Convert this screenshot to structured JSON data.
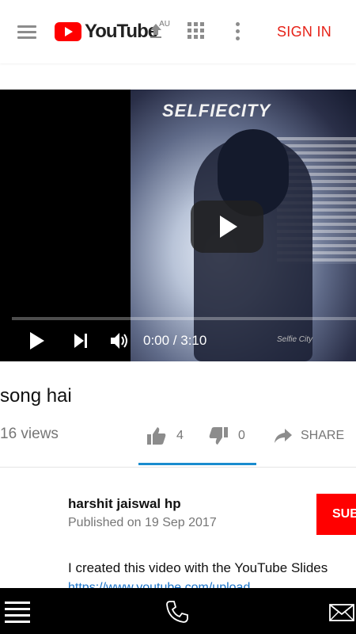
{
  "header": {
    "logo_text": "YouTube",
    "region_text": "AU",
    "signin_label": "SIGN IN",
    "icons": [
      "menu-icon",
      "upload-icon",
      "apps-icon",
      "more-vert-icon"
    ]
  },
  "player": {
    "thumbnail_title": "SELFIECITY",
    "thumbnail_signature": "Selfie City",
    "time": "0:00 / 3:10",
    "progress": 0,
    "icons": [
      "play-icon",
      "skip-next-icon",
      "volume-icon",
      "large-play-icon"
    ]
  },
  "video": {
    "title": "song hai",
    "views": "16 views",
    "likes": "4",
    "dislikes": "0",
    "share_label": "SHARE"
  },
  "channel": {
    "name": "harshit jaiswal hp",
    "published": "Published on 19 Sep 2017",
    "subscribe_label": "SUB",
    "description": "I created this video with the YouTube Slides",
    "description_link": "https://www.youtube.com/upload"
  },
  "bottom_bar": {
    "icons": [
      "menu-icon",
      "phone-icon",
      "mail-icon"
    ]
  },
  "colors": {
    "accent_red": "#ff0000",
    "signin_red": "#e62117",
    "active_tab_blue": "#1a8ccf"
  }
}
